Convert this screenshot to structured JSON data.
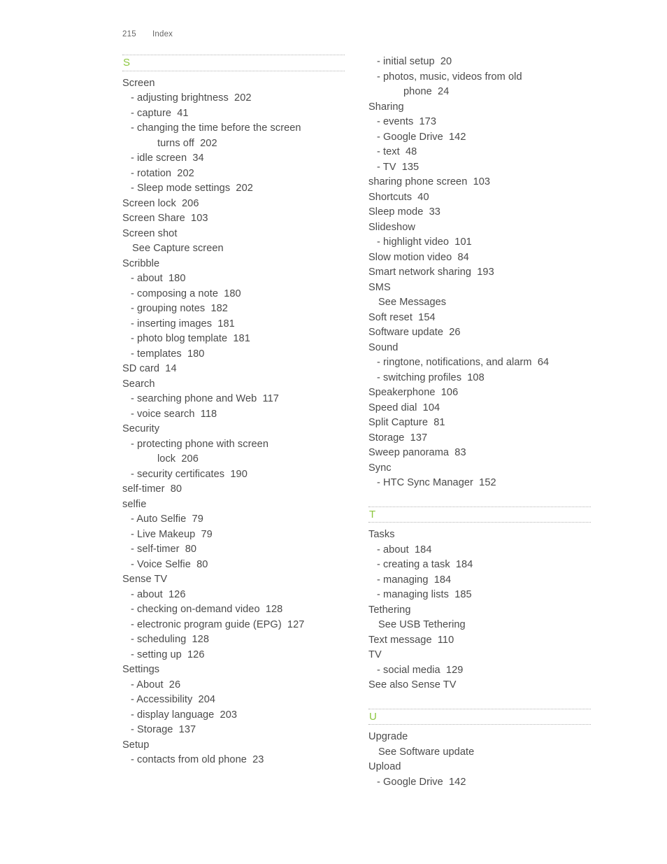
{
  "header": {
    "folio": "215",
    "label": "Index"
  },
  "theme": {
    "letter_color": "#8cc63f",
    "text_color": "#4b4b4b",
    "rule_color": "#b4b4b4"
  },
  "columns": {
    "left": [
      {
        "letter": "S",
        "entries": [
          {
            "level": 0,
            "text": "Screen"
          },
          {
            "level": 1,
            "text": "- adjusting brightness  202"
          },
          {
            "level": 1,
            "text": "- capture  41"
          },
          {
            "level": 1,
            "text": "- changing the time before the screen"
          },
          {
            "level": 2,
            "text": "turns off  202"
          },
          {
            "level": 1,
            "text": "- idle screen  34"
          },
          {
            "level": 1,
            "text": "- rotation  202"
          },
          {
            "level": 1,
            "text": "- Sleep mode settings  202"
          },
          {
            "level": 0,
            "text": "Screen lock  206"
          },
          {
            "level": 0,
            "text": "Screen Share  103"
          },
          {
            "level": 0,
            "text": "Screen shot"
          },
          {
            "level": "see",
            "text": "See Capture screen"
          },
          {
            "level": 0,
            "text": "Scribble"
          },
          {
            "level": 1,
            "text": "- about  180"
          },
          {
            "level": 1,
            "text": "- composing a note  180"
          },
          {
            "level": 1,
            "text": "- grouping notes  182"
          },
          {
            "level": 1,
            "text": "- inserting images  181"
          },
          {
            "level": 1,
            "text": "- photo blog template  181"
          },
          {
            "level": 1,
            "text": "- templates  180"
          },
          {
            "level": 0,
            "text": "SD card  14"
          },
          {
            "level": 0,
            "text": "Search"
          },
          {
            "level": 1,
            "text": "- searching phone and Web  117"
          },
          {
            "level": 1,
            "text": "- voice search  118"
          },
          {
            "level": 0,
            "text": "Security"
          },
          {
            "level": 1,
            "text": "- protecting phone with screen"
          },
          {
            "level": 2,
            "text": "lock  206"
          },
          {
            "level": 1,
            "text": "- security certificates  190"
          },
          {
            "level": 0,
            "text": "self-timer  80"
          },
          {
            "level": 0,
            "text": "selfie"
          },
          {
            "level": 1,
            "text": "- Auto Selfie  79"
          },
          {
            "level": 1,
            "text": "- Live Makeup  79"
          },
          {
            "level": 1,
            "text": "- self-timer  80"
          },
          {
            "level": 1,
            "text": "- Voice Selfie  80"
          },
          {
            "level": 0,
            "text": "Sense TV"
          },
          {
            "level": 1,
            "text": "- about  126"
          },
          {
            "level": 1,
            "text": "- checking on-demand video  128"
          },
          {
            "level": 1,
            "text": "- electronic program guide (EPG)  127"
          },
          {
            "level": 1,
            "text": "- scheduling  128"
          },
          {
            "level": 1,
            "text": "- setting up  126"
          },
          {
            "level": 0,
            "text": "Settings"
          },
          {
            "level": 1,
            "text": "- About  26"
          },
          {
            "level": 1,
            "text": "- Accessibility  204"
          },
          {
            "level": 1,
            "text": "- display language  203"
          },
          {
            "level": 1,
            "text": "- Storage  137"
          },
          {
            "level": 0,
            "text": "Setup"
          },
          {
            "level": 1,
            "text": "- contacts from old phone  23"
          }
        ]
      }
    ],
    "right": [
      {
        "letter": null,
        "entries": [
          {
            "level": 1,
            "text": "- initial setup  20"
          },
          {
            "level": 1,
            "text": "- photos, music, videos from old"
          },
          {
            "level": 2,
            "text": "phone  24"
          },
          {
            "level": 0,
            "text": "Sharing"
          },
          {
            "level": 1,
            "text": "- events  173"
          },
          {
            "level": 1,
            "text": "- Google Drive  142"
          },
          {
            "level": 1,
            "text": "- text  48"
          },
          {
            "level": 1,
            "text": "- TV  135"
          },
          {
            "level": 0,
            "text": "sharing phone screen  103"
          },
          {
            "level": 0,
            "text": "Shortcuts  40"
          },
          {
            "level": 0,
            "text": "Sleep mode  33"
          },
          {
            "level": 0,
            "text": "Slideshow"
          },
          {
            "level": 1,
            "text": "- highlight video  101"
          },
          {
            "level": 0,
            "text": "Slow motion video  84"
          },
          {
            "level": 0,
            "text": "Smart network sharing  193"
          },
          {
            "level": 0,
            "text": "SMS"
          },
          {
            "level": "see",
            "text": "See Messages"
          },
          {
            "level": 0,
            "text": "Soft reset  154"
          },
          {
            "level": 0,
            "text": "Software update  26"
          },
          {
            "level": 0,
            "text": "Sound"
          },
          {
            "level": 1,
            "text": "- ringtone, notifications, and alarm  64"
          },
          {
            "level": 1,
            "text": "- switching profiles  108"
          },
          {
            "level": 0,
            "text": "Speakerphone  106"
          },
          {
            "level": 0,
            "text": "Speed dial  104"
          },
          {
            "level": 0,
            "text": "Split Capture  81"
          },
          {
            "level": 0,
            "text": "Storage  137"
          },
          {
            "level": 0,
            "text": "Sweep panorama  83"
          },
          {
            "level": 0,
            "text": "Sync"
          },
          {
            "level": 1,
            "text": "- HTC Sync Manager  152"
          }
        ]
      },
      {
        "letter": "T",
        "entries": [
          {
            "level": 0,
            "text": "Tasks"
          },
          {
            "level": 1,
            "text": "- about  184"
          },
          {
            "level": 1,
            "text": "- creating a task  184"
          },
          {
            "level": 1,
            "text": "- managing  184"
          },
          {
            "level": 1,
            "text": "- managing lists  185"
          },
          {
            "level": 0,
            "text": "Tethering"
          },
          {
            "level": "see",
            "text": "See USB Tethering"
          },
          {
            "level": 0,
            "text": "Text message  110"
          },
          {
            "level": 0,
            "text": "TV"
          },
          {
            "level": 1,
            "text": "- social media  129"
          },
          {
            "level": "see0",
            "text": "See also Sense TV"
          }
        ]
      },
      {
        "letter": "U",
        "entries": [
          {
            "level": 0,
            "text": "Upgrade"
          },
          {
            "level": "see",
            "text": "See Software update"
          },
          {
            "level": 0,
            "text": "Upload"
          },
          {
            "level": 1,
            "text": "- Google Drive  142"
          }
        ]
      }
    ]
  }
}
